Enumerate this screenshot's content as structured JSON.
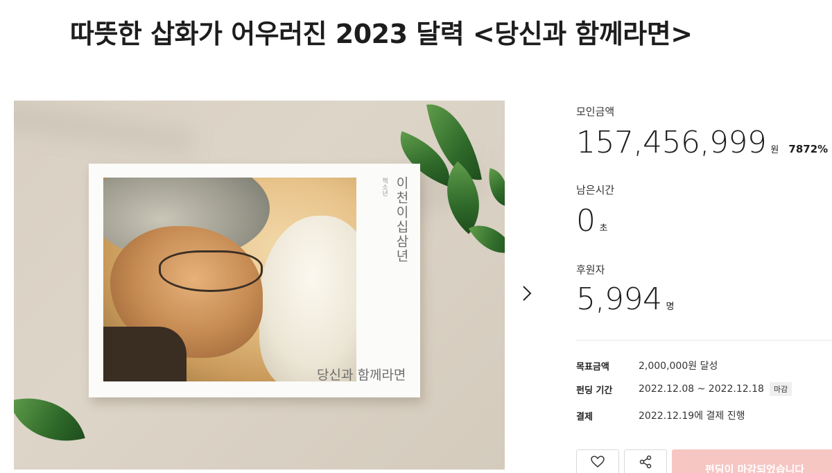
{
  "header": {
    "title": "따뜻한 삽화가 어우러진 2023 달력 <당신과 함께라면>"
  },
  "gallery": {
    "vertical_title": "이천이십삼년",
    "vertical_small": "책소년",
    "caption": "당신과 함께라면",
    "next_icon": "chevron-right-icon"
  },
  "stats": {
    "raised": {
      "label": "모인금액",
      "value": "157,456,999",
      "unit": "원",
      "percent": "7872%"
    },
    "remaining": {
      "label": "남은시간",
      "value": "0",
      "unit": "초"
    },
    "backers": {
      "label": "후원자",
      "value": "5,994",
      "unit": "명"
    }
  },
  "info": {
    "goal": {
      "label": "목표금액",
      "value": "2,000,000원 달성"
    },
    "period": {
      "label": "펀딩 기간",
      "value": "2022.12.08 ~ 2022.12.18",
      "badge": "마감"
    },
    "payment": {
      "label": "결제",
      "value": "2022.12.19에 결제 진행"
    }
  },
  "actions": {
    "like_icon": "heart-icon",
    "share_icon": "share-icon",
    "cta_label": "펀딩이 마감되었습니다"
  },
  "colors": {
    "cta_bg": "#f6c6c3",
    "text": "#1d1d1d"
  }
}
